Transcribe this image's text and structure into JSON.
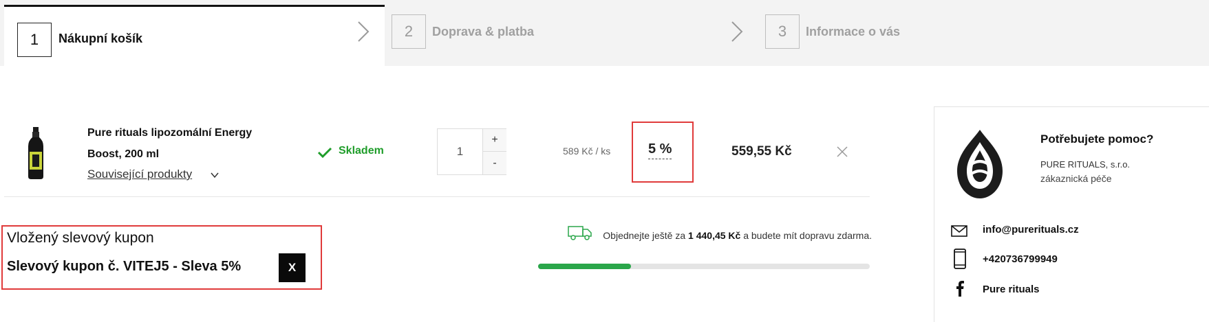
{
  "steps": [
    {
      "number": "1",
      "label": "Nákupní košík"
    },
    {
      "number": "2",
      "label": "Doprava & platba"
    },
    {
      "number": "3",
      "label": "Informace o vás"
    }
  ],
  "cart_item": {
    "name": "Pure rituals lipozomální Energy Boost, 200 ml",
    "related_link": "Související produkty",
    "stock": "Skladem",
    "quantity": "1",
    "qty_plus": "+",
    "qty_minus": "-",
    "unit_price": "589 Kč / ks",
    "discount": "5 %",
    "total": "559,55 Kč"
  },
  "coupon": {
    "title": "Vložený slevový kupon",
    "code_text": "Slevový kupon č. VITEJ5 - Sleva 5%",
    "remove_label": "X"
  },
  "shipping": {
    "text_before": "Objednejte ještě za",
    "amount": "1 440,45 Kč",
    "text_after": "a budete mít dopravu zdarma.",
    "progress_fraction": 0.28
  },
  "help": {
    "title": "Potřebujete pomoc?",
    "company": "PURE RITUALS, s.r.o.",
    "role": "zákaznická péče",
    "email": "info@purerituals.cz",
    "phone": "+420736799949",
    "facebook": "Pure rituals"
  },
  "colors": {
    "accent_green": "#2aa64a",
    "stock_green": "#1f9d2a",
    "highlight_red": "#e03a3a"
  },
  "icons": {
    "chevron": "chevron-right-icon",
    "check": "check-icon",
    "truck": "truck-icon",
    "close": "close-icon",
    "email": "envelope-icon",
    "phone": "phone-icon",
    "facebook": "facebook-icon"
  }
}
